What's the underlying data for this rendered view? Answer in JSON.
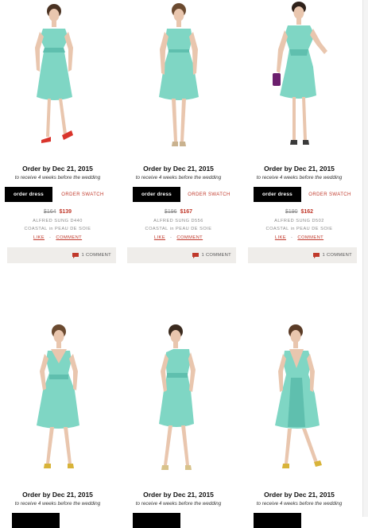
{
  "colors": {
    "dress": "#7fd6c4",
    "dress_shadow": "#5fbfae",
    "skin": "#e9c6ae",
    "hair": "#4a3222",
    "accent_red": "#c0392b",
    "button_black": "#000000",
    "comment_bar": "#efedea"
  },
  "icons": {
    "comment": "speech-bubble-icon"
  },
  "rows": [
    {
      "products": [
        {
          "deadline": "Order by Dec 21, 2015",
          "subline": "to receive 4 weeks before the wedding",
          "order_label": "order dress",
          "swatch_label": "ORDER SWATCH",
          "old_price": "$164",
          "new_price": "$139",
          "designer": "ALFRED SUNG D440",
          "fabric": "COASTAL in PEAU DE SOIE",
          "like_label": "LIKE",
          "separator": "-",
          "comment_label": "COMMENT",
          "comment_count": "1 COMMENT"
        },
        {
          "deadline": "Order by Dec 21, 2015",
          "subline": "to receive 4 weeks before the wedding",
          "order_label": "order dress",
          "swatch_label": "ORDER SWATCH",
          "old_price": "$196",
          "new_price": "$167",
          "designer": "ALFRED SUNG D556",
          "fabric": "COASTAL in PEAU DE SOIE",
          "like_label": "LIKE",
          "separator": "-",
          "comment_label": "COMMENT",
          "comment_count": "1 COMMENT"
        },
        {
          "deadline": "Order by Dec 21, 2015",
          "subline": "to receive 4 weeks before the wedding",
          "order_label": "order dress",
          "swatch_label": "ORDER SWATCH",
          "old_price": "$190",
          "new_price": "$162",
          "designer": "ALFRED SUNG D502",
          "fabric": "COASTAL in PEAU DE SOIE",
          "like_label": "LIKE",
          "separator": "-",
          "comment_label": "COMMENT",
          "comment_count": "1 COMMENT"
        }
      ]
    },
    {
      "products": [
        {
          "deadline": "Order by Dec 21, 2015",
          "subline": "to receive 4 weeks before the wedding"
        },
        {
          "deadline": "Order by Dec 21, 2015",
          "subline": "to receive 4 weeks before the wedding"
        },
        {
          "deadline": "Order by Dec 21, 2015",
          "subline": "to receive 4 weeks before the wedding"
        }
      ]
    }
  ]
}
